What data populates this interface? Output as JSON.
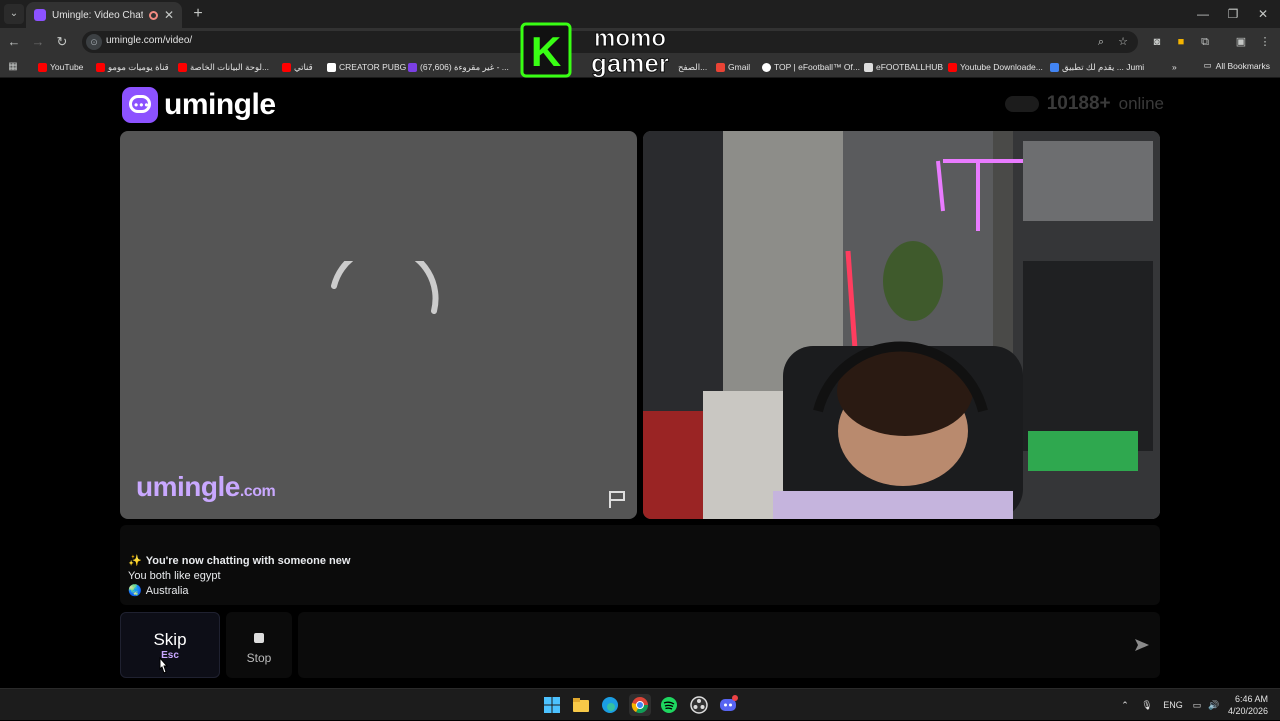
{
  "browser": {
    "tab_title": "Umingle: Video Chat with S",
    "url": "umingle.com/video/",
    "bookmarks": [
      {
        "label": "YouTube",
        "color": "#ff0000"
      },
      {
        "label": "قناة يوميات مومو",
        "color": "#ff0000"
      },
      {
        "label": "لوحة البيانات الخاصة...",
        "color": "#ff0000"
      },
      {
        "label": "قناتي",
        "color": "#ff0000"
      },
      {
        "label": "CREATOR PUBG",
        "color": "#ffffff"
      },
      {
        "label": "(67,606) غير مقروءة - ...",
        "color": "#7b3fe4"
      },
      {
        "label": "الصفح...",
        "color": "#4285f4"
      },
      {
        "label": "Gmail",
        "color": "#ea4335"
      },
      {
        "label": "TOP | eFootball™ Of...",
        "color": "#ffffff"
      },
      {
        "label": "eFOOTBALLHUB",
        "color": "#ffffff"
      },
      {
        "label": "Youtube Downloade...",
        "color": "#ff0000"
      },
      {
        "label": "يقدم لك تطبيق ... Jumi",
        "color": "#4285f4"
      }
    ],
    "all_bookmarks_label": "All Bookmarks"
  },
  "overlay_logo": {
    "line1": "momo",
    "line2": "gamer",
    "letter": "K"
  },
  "site": {
    "brand_name": "umingle",
    "online_count": "10188+",
    "online_label": "online",
    "watermark_name": "umingle",
    "watermark_suffix": ".com",
    "accent_color": "#8c52ff"
  },
  "chat": {
    "messages": [
      {
        "icon": "✨",
        "text": "You're now chatting with someone new"
      },
      {
        "icon": "",
        "text": "You both like egypt"
      },
      {
        "icon": "🌏",
        "text": "Australia"
      }
    ]
  },
  "controls": {
    "skip_label": "Skip",
    "skip_key": "Esc",
    "stop_label": "Stop",
    "message_placeholder": ""
  },
  "taskbar": {
    "language": "ENG",
    "time": "6:46 AM",
    "date": "4/20/2026"
  }
}
